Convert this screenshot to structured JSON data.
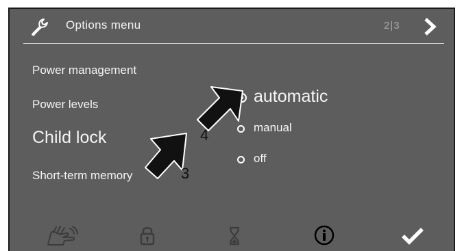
{
  "header": {
    "title": "Options menu",
    "page_indicator": "2|3",
    "settings_icon": "wrench-icon",
    "next_icon": "chevron-right-icon"
  },
  "menu": {
    "items": [
      {
        "label": "Power management"
      },
      {
        "label": "Power levels"
      },
      {
        "label": "Child lock",
        "selected": true
      },
      {
        "label": "Short-term memory"
      }
    ]
  },
  "child_lock_options": {
    "selected": "automatic",
    "options": [
      {
        "label": "automatic",
        "checked": true
      },
      {
        "label": "manual",
        "checked": false
      },
      {
        "label": "off",
        "checked": false
      }
    ]
  },
  "callouts": [
    {
      "number": "4"
    },
    {
      "number": "3"
    }
  ],
  "footer": {
    "icons": [
      "hand-icon",
      "lock-icon",
      "hourglass-icon",
      "info-icon",
      "checkmark-icon"
    ]
  },
  "colors": {
    "screen_background": "#5d5d5d",
    "text": "#ffffff",
    "page_indicator": "#a9a9a9",
    "callout_arrow": "#111111"
  }
}
